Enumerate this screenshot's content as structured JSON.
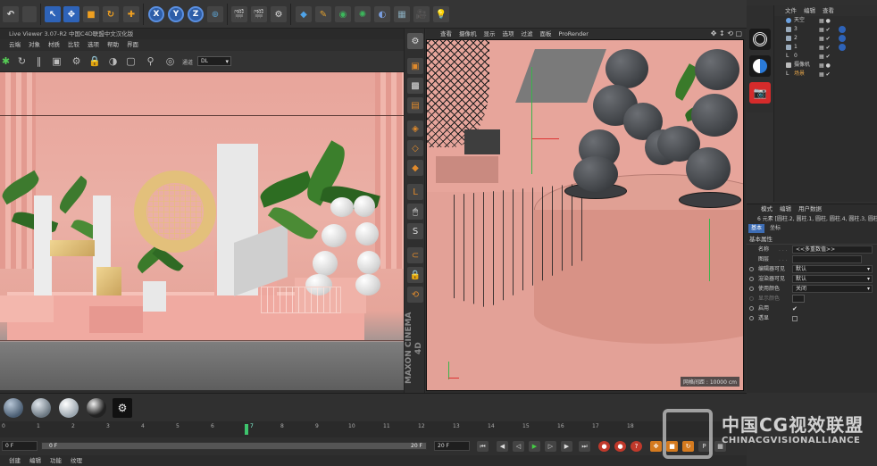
{
  "colors": {
    "accent_blue": "#2e63b8",
    "render_pink": "#e8a59b",
    "playhead_green": "#3ec46d",
    "selected_orange": "#e3a34a"
  },
  "toolbar": {
    "axis_x": "X",
    "axis_y": "Y",
    "axis_z": "Z",
    "icons": [
      "undo-icon",
      "cursor-icon",
      "move-icon",
      "scale-icon",
      "rotate-icon",
      "last-tool-icon",
      "axis-x-icon",
      "axis-y-icon",
      "axis-z-icon",
      "coordinate-icon",
      "render-view-icon",
      "render-picture-icon",
      "render-settings-icon",
      "cube-icon",
      "pen-icon",
      "subdivision-icon",
      "cloner-icon",
      "deformer-icon",
      "floor-icon",
      "camera-icon",
      "light-icon"
    ]
  },
  "live_viewer": {
    "title": "Live Viewer 3.07-R2 中国C4D联盟中文汉化版",
    "menu": [
      "云端",
      "对象",
      "材质",
      "比较",
      "选项",
      "帮助",
      "界面"
    ],
    "mode_label": "通道",
    "mode_value": "DL"
  },
  "viewport": {
    "menu": [
      "查看",
      "摄像机",
      "显示",
      "选项",
      "过滤",
      "面板",
      "ProRender"
    ],
    "grid_label": "网格间距 : 10000 cm"
  },
  "maxon": {
    "brand": "MAXON",
    "product": "CINEMA 4D"
  },
  "object_manager": {
    "menu": [
      "文件",
      "编辑",
      "查看"
    ],
    "rows": [
      {
        "name": "天空",
        "selected": false
      },
      {
        "name": "3",
        "selected": false
      },
      {
        "name": "2",
        "selected": false
      },
      {
        "name": "1",
        "selected": false
      },
      {
        "name": "0",
        "selected": false
      },
      {
        "name": "摄像机",
        "selected": false
      },
      {
        "name": "场景",
        "selected": true
      }
    ]
  },
  "attribute_manager": {
    "menu": [
      "模式",
      "编辑",
      "用户数据"
    ],
    "elements": "6 元素 [圆柱.2, 圆柱.1, 圆柱, 圆柱.4, 圆柱.3, 圆柱.5]",
    "tabs": [
      "基本",
      "坐标"
    ],
    "section": "基本属性",
    "fields": [
      {
        "label": "名称",
        "value": "<<多重数值>>",
        "kind": "text"
      },
      {
        "label": "图层",
        "value": "",
        "kind": "text"
      },
      {
        "label": "编辑器可见",
        "value": "默认",
        "kind": "select"
      },
      {
        "label": "渲染器可见",
        "value": "默认",
        "kind": "select"
      },
      {
        "label": "使用颜色",
        "value": "关闭",
        "kind": "select"
      },
      {
        "label": "显示颜色",
        "value": "",
        "kind": "swatch"
      },
      {
        "label": "启用",
        "value": "✔",
        "kind": "check"
      },
      {
        "label": "透显",
        "value": "",
        "kind": "check"
      }
    ]
  },
  "timeline": {
    "ticks": [
      "0",
      "1",
      "2",
      "3",
      "4",
      "5",
      "6",
      "7",
      "8",
      "9",
      "10",
      "11",
      "12",
      "13",
      "14",
      "15",
      "16",
      "17",
      "18"
    ],
    "current_frame": "7",
    "start_field": "0 F",
    "range_start": "0 F",
    "range_end": "20 F",
    "end_field": "20 F"
  },
  "bottom_menu": [
    "创建",
    "编辑",
    "功能",
    "纹理"
  ],
  "watermark": {
    "cn": "中国CG视效联盟",
    "en": "CHINACGVISIONALLIANCE"
  }
}
